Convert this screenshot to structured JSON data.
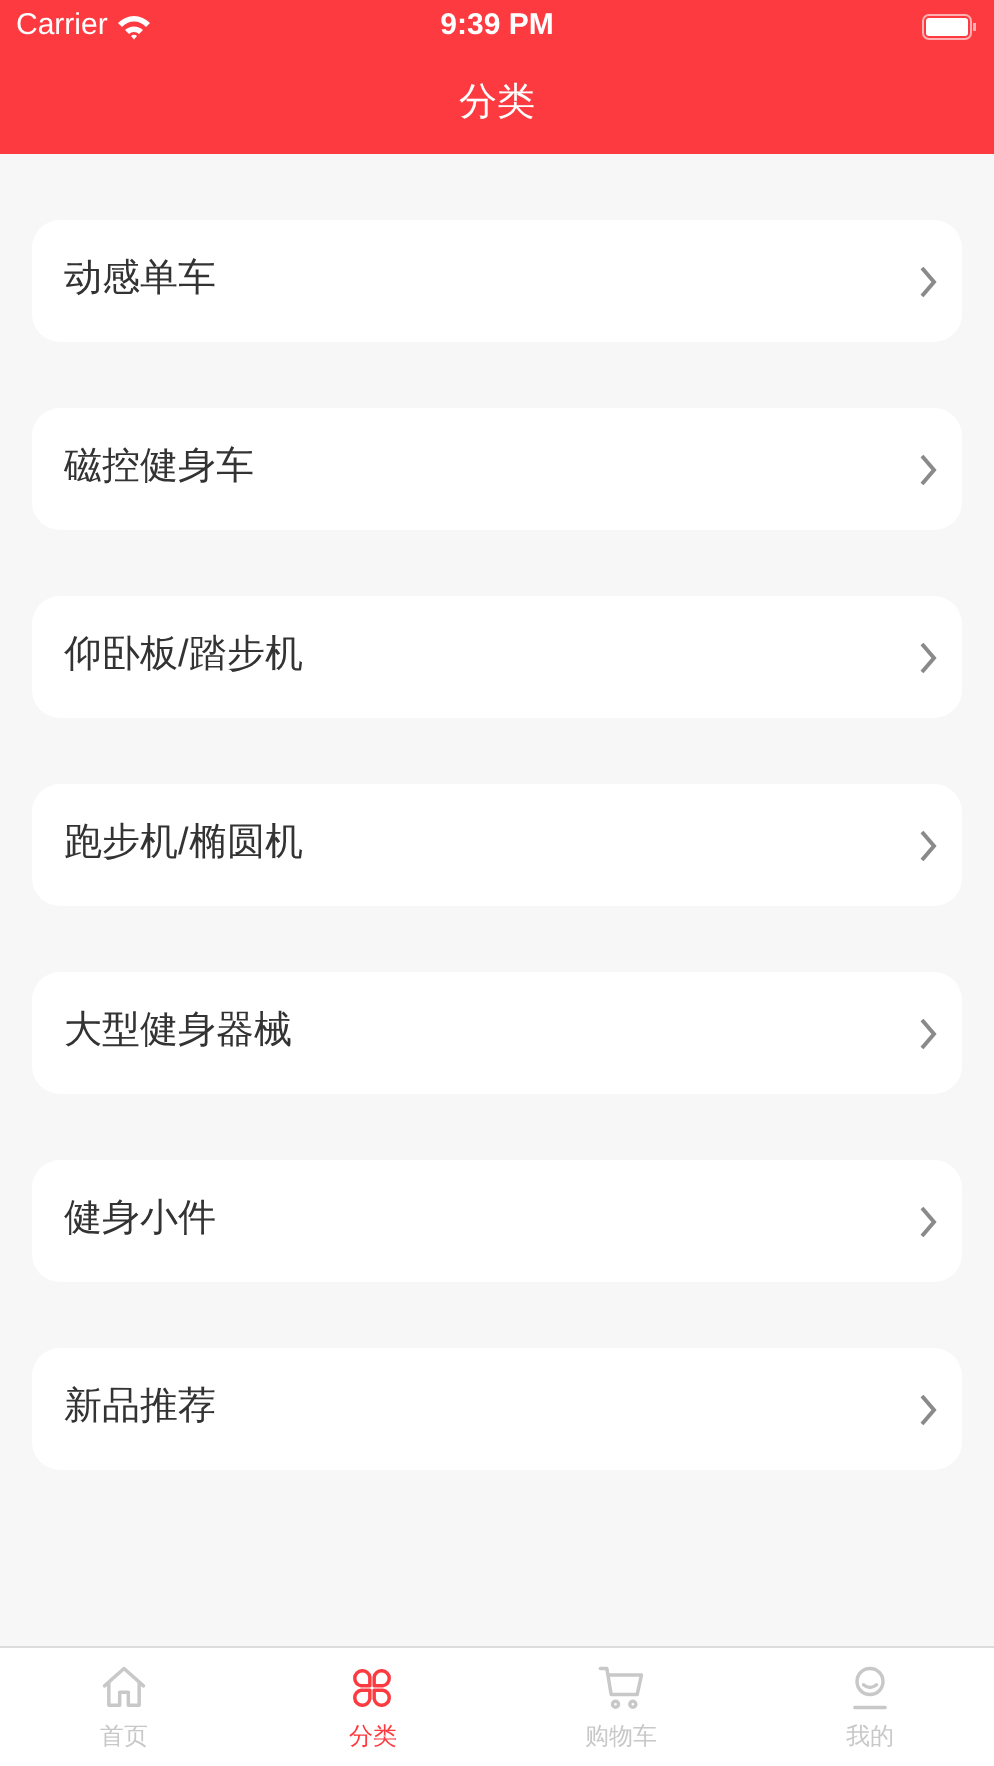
{
  "status_bar": {
    "carrier": "Carrier",
    "time": "9:39 PM"
  },
  "header": {
    "title": "分类"
  },
  "categories": [
    {
      "label": "动感单车"
    },
    {
      "label": "磁控健身车"
    },
    {
      "label": "仰卧板/踏步机"
    },
    {
      "label": "跑步机/椭圆机"
    },
    {
      "label": "大型健身器械"
    },
    {
      "label": "健身小件"
    },
    {
      "label": "新品推荐"
    }
  ],
  "tab_bar": [
    {
      "kind": "home",
      "label": "首页",
      "selected": false
    },
    {
      "kind": "category",
      "label": "分类",
      "selected": true
    },
    {
      "kind": "cart",
      "label": "购物车",
      "selected": false
    },
    {
      "kind": "profile",
      "label": "我的",
      "selected": false
    }
  ]
}
